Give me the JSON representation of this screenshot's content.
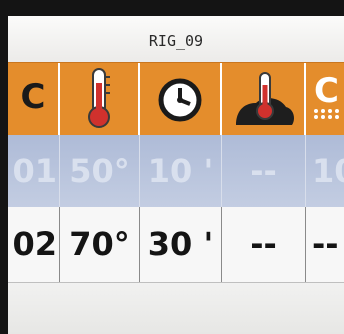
{
  "screen": {
    "title": "RIG_09"
  },
  "header": {
    "cols": [
      {
        "id": "program",
        "label": "C"
      },
      {
        "id": "temperature",
        "icon": "thermometer-icon"
      },
      {
        "id": "time",
        "icon": "clock-icon"
      },
      {
        "id": "core_probe",
        "icon": "core-probe-icon"
      },
      {
        "id": "steam",
        "label": "C"
      }
    ]
  },
  "rows": [
    {
      "id": "01",
      "temp": "50°",
      "time": "10 '",
      "probe": "--",
      "extra": "10",
      "dimmed": true
    },
    {
      "id": "02",
      "temp": "70°",
      "time": "30 '",
      "probe": "--",
      "extra": "--",
      "dimmed": false
    }
  ],
  "colors": {
    "header_bg": "#e48d2c",
    "selected_row_bg": "#b7c3dc",
    "row_bg": "#f7f7f7",
    "thermometer_red": "#d0312d"
  }
}
